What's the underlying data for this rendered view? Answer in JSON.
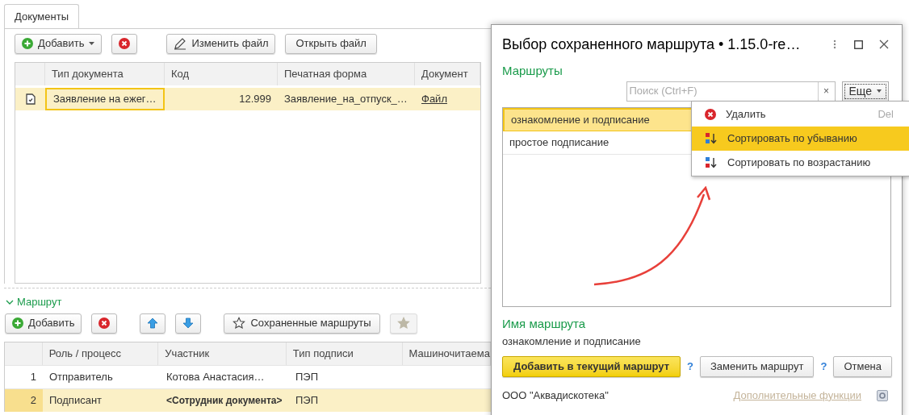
{
  "tabs": [
    {
      "label": "Документы",
      "selected": true
    }
  ],
  "documents": {
    "toolbar": {
      "add": "Добавить",
      "edit_file": "Изменить файл",
      "open_file": "Открыть файл"
    },
    "columns": [
      "Тип документа",
      "Код",
      "Печатная форма",
      "Документ"
    ],
    "rows": [
      {
        "type": "Заявление на ежег…",
        "code": "12.999",
        "print_form": "Заявление_на_отпуск_…",
        "document": "Файл",
        "selected": true
      }
    ]
  },
  "route": {
    "title": "Маршрут",
    "expanded": true,
    "toolbar": {
      "add": "Добавить",
      "saved_routes": "Сохраненные маршруты",
      "favorite_disabled": true
    },
    "columns": [
      "Роль / процесс",
      "Участник",
      "Тип подписи",
      "Машиночитаема"
    ],
    "rows": [
      {
        "number": "1",
        "role": "Отправитель",
        "participant": "Котова Анастасия…",
        "participant_bold": false,
        "signature": "ПЭП",
        "selected": false
      },
      {
        "number": "2",
        "role": "Подписант",
        "participant": "<Сотрудник документа>",
        "participant_bold": true,
        "signature": "ПЭП",
        "selected": true
      }
    ]
  },
  "dialog": {
    "title": "Выбор сохраненного маршрута • 1.15.0-re…",
    "section": "Маршруты",
    "search": {
      "placeholder": "Поиск (Ctrl+F)"
    },
    "clear": "×",
    "more": "Еще",
    "routes": [
      {
        "name": "ознакомление и подписание",
        "selected": true
      },
      {
        "name": "простое подписание",
        "selected": false
      }
    ],
    "menu": [
      {
        "kind": "delete",
        "label": "Удалить",
        "shortcut": "Del",
        "selected": false
      },
      {
        "kind": "sort_desc",
        "label": "Сортировать по убыванию",
        "selected": true
      },
      {
        "kind": "sort_asc",
        "label": "Сортировать по возрастанию",
        "selected": false
      }
    ],
    "name_label": "Имя маршрута",
    "name_value": "ознакомление и подписание",
    "buttons": [
      {
        "kind": "primary",
        "label": "Добавить в текущий маршрут",
        "help": "?"
      },
      {
        "kind": "default",
        "label": "Заменить маршрут",
        "help": "?"
      },
      {
        "kind": "default",
        "label": "Отмена"
      }
    ],
    "organization": "ООО \"Аквадискотека\"",
    "more_functions": "Дополнительные функции"
  }
}
